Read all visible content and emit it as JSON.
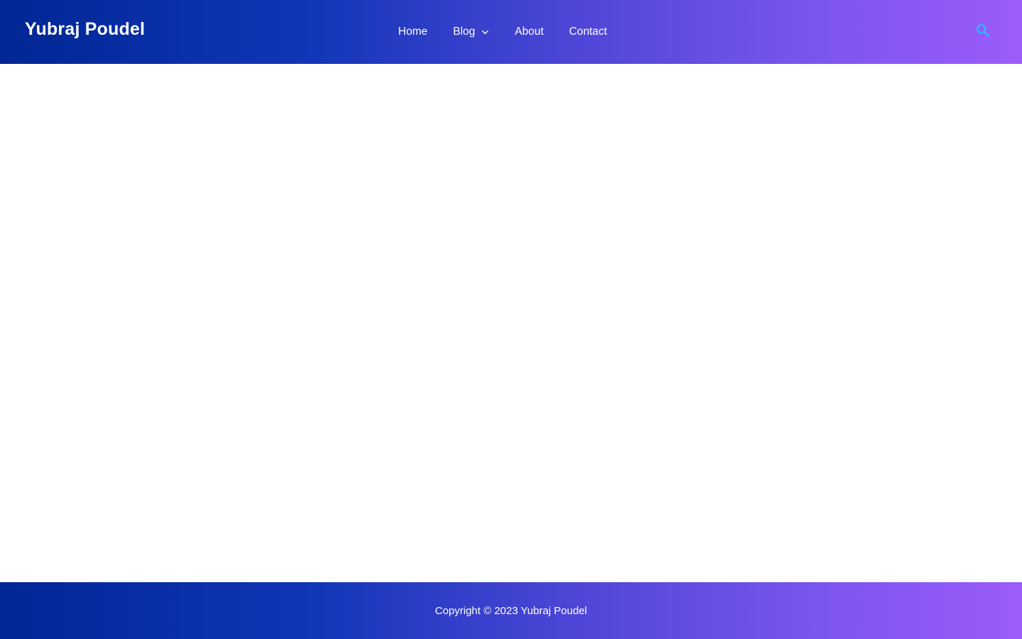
{
  "header": {
    "site_title": "Yubraj Poudel",
    "nav": {
      "home": "Home",
      "blog": "Blog",
      "about": "About",
      "contact": "Contact"
    },
    "search_icon": "search-icon",
    "blog_dropdown_icon": "chevron-down-icon"
  },
  "footer": {
    "copyright": "Copyright © 2023 Yubraj Poudel"
  },
  "colors": {
    "gradient_start": "#012694",
    "gradient_end": "#9c5cfb",
    "search_icon": "#2fb7ff",
    "text": "#ffffff",
    "background": "#ffffff"
  }
}
